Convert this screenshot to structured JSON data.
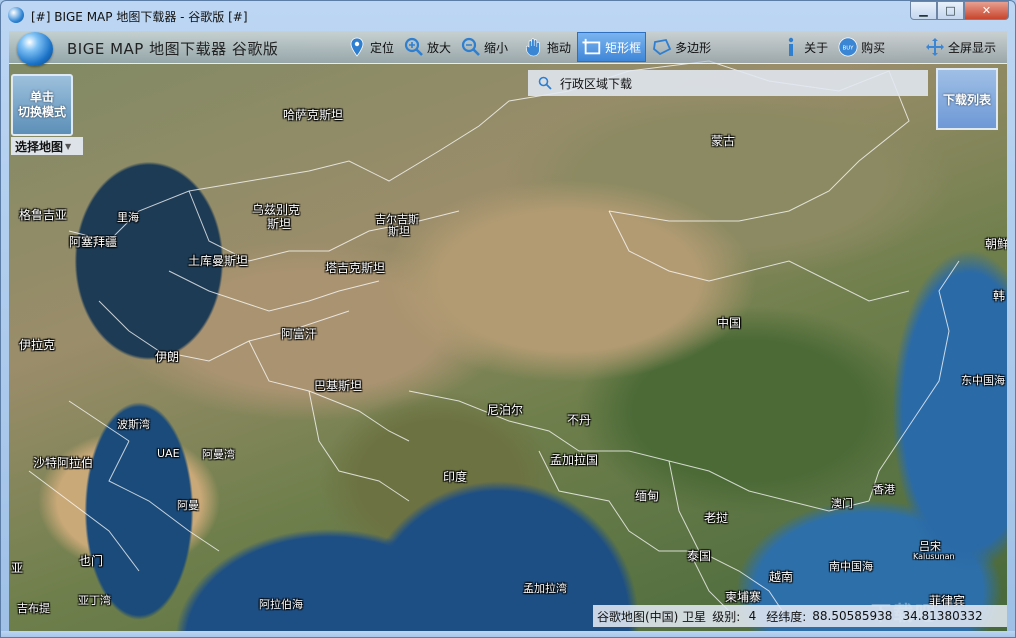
{
  "window": {
    "title": "[#] BIGE MAP 地图下载器 - 谷歌版 [#]",
    "controls": {
      "minimize": "▁",
      "maximize": "□",
      "close": "✕"
    }
  },
  "toolbar": {
    "app_name": "BIGE MAP 地图下载器 谷歌版",
    "tools": [
      {
        "id": "locate",
        "label": "定位",
        "icon": "location-pin-icon"
      },
      {
        "id": "zoom-in",
        "label": "放大",
        "icon": "zoom-in-icon"
      },
      {
        "id": "zoom-out",
        "label": "缩小",
        "icon": "zoom-out-icon"
      },
      {
        "id": "pan",
        "label": "拖动",
        "icon": "hand-icon"
      },
      {
        "id": "rectangle",
        "label": "矩形框",
        "icon": "rectangle-select-icon",
        "active": true
      },
      {
        "id": "polygon",
        "label": "多边形",
        "icon": "polygon-icon"
      },
      {
        "id": "about",
        "label": "关于",
        "icon": "info-icon"
      },
      {
        "id": "buy",
        "label": "购买",
        "icon": "buy-icon"
      }
    ],
    "fullscreen_label": "全屏显示"
  },
  "mode_switch": {
    "line1": "单击",
    "line2": "切换模式"
  },
  "select_map": {
    "label": "选择地图"
  },
  "region_download": {
    "label": "行政区域下载"
  },
  "download_list": {
    "label": "下载列表"
  },
  "map_labels": [
    {
      "text": "哈萨克斯坦"
    },
    {
      "text": "蒙古"
    },
    {
      "text": "格鲁吉亚"
    },
    {
      "text": "里海"
    },
    {
      "text": "乌兹别克"
    },
    {
      "text": "斯坦"
    },
    {
      "text": "吉尔吉斯"
    },
    {
      "text": "斯坦"
    },
    {
      "text": "阿塞拜疆"
    },
    {
      "text": "土库曼斯坦"
    },
    {
      "text": "塔吉克斯坦"
    },
    {
      "text": "朝鲜"
    },
    {
      "text": "韩"
    },
    {
      "text": "伊拉克"
    },
    {
      "text": "阿富汗"
    },
    {
      "text": "中国"
    },
    {
      "text": "伊朗"
    },
    {
      "text": "巴基斯坦"
    },
    {
      "text": "东中国海"
    },
    {
      "text": "波斯湾"
    },
    {
      "text": "尼泊尔"
    },
    {
      "text": "不丹"
    },
    {
      "text": "UAE"
    },
    {
      "text": "阿曼湾"
    },
    {
      "text": "沙特阿拉伯"
    },
    {
      "text": "孟加拉国"
    },
    {
      "text": "印度"
    },
    {
      "text": "缅甸"
    },
    {
      "text": "香港"
    },
    {
      "text": "阿曼"
    },
    {
      "text": "澳门"
    },
    {
      "text": "老挝"
    },
    {
      "text": "吕宋"
    },
    {
      "text": "Kalusunan"
    },
    {
      "text": "也门"
    },
    {
      "text": "泰国"
    },
    {
      "text": "南中国海"
    },
    {
      "text": "越南"
    },
    {
      "text": "亚"
    },
    {
      "text": "孟加拉湾"
    },
    {
      "text": "亚丁湾"
    },
    {
      "text": "柬埔寨"
    },
    {
      "text": "菲律宾"
    },
    {
      "text": "吉布提"
    },
    {
      "text": "阿拉伯海"
    }
  ],
  "status": {
    "map_source": "谷歌地图(中国) 卫星",
    "level_label": "级别:",
    "level_value": "4",
    "coord_label": "经纬度:",
    "longitude": "88.50585938",
    "latitude": "34.81380332"
  },
  "colors": {
    "active_tool": "#3f86d8",
    "toolbar_bg": "#c8d8ea",
    "title_bg": "#a9c9ec"
  }
}
